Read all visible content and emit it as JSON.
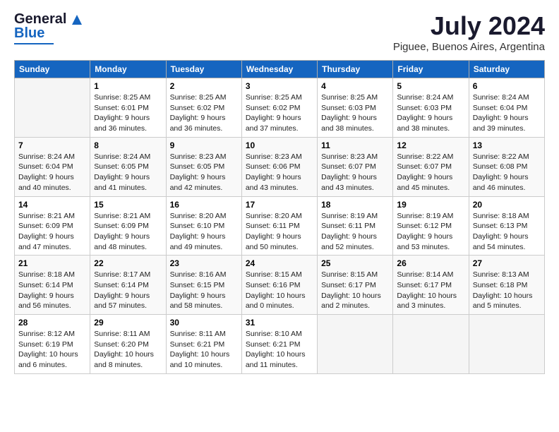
{
  "header": {
    "logo_line1": "General",
    "logo_line2": "Blue",
    "title": "July 2024",
    "subtitle": "Piguee, Buenos Aires, Argentina"
  },
  "days_of_week": [
    "Sunday",
    "Monday",
    "Tuesday",
    "Wednesday",
    "Thursday",
    "Friday",
    "Saturday"
  ],
  "weeks": [
    [
      {
        "num": "",
        "sunrise": "",
        "sunset": "",
        "daylight": ""
      },
      {
        "num": "1",
        "sunrise": "Sunrise: 8:25 AM",
        "sunset": "Sunset: 6:01 PM",
        "daylight": "Daylight: 9 hours and 36 minutes."
      },
      {
        "num": "2",
        "sunrise": "Sunrise: 8:25 AM",
        "sunset": "Sunset: 6:02 PM",
        "daylight": "Daylight: 9 hours and 36 minutes."
      },
      {
        "num": "3",
        "sunrise": "Sunrise: 8:25 AM",
        "sunset": "Sunset: 6:02 PM",
        "daylight": "Daylight: 9 hours and 37 minutes."
      },
      {
        "num": "4",
        "sunrise": "Sunrise: 8:25 AM",
        "sunset": "Sunset: 6:03 PM",
        "daylight": "Daylight: 9 hours and 38 minutes."
      },
      {
        "num": "5",
        "sunrise": "Sunrise: 8:24 AM",
        "sunset": "Sunset: 6:03 PM",
        "daylight": "Daylight: 9 hours and 38 minutes."
      },
      {
        "num": "6",
        "sunrise": "Sunrise: 8:24 AM",
        "sunset": "Sunset: 6:04 PM",
        "daylight": "Daylight: 9 hours and 39 minutes."
      }
    ],
    [
      {
        "num": "7",
        "sunrise": "Sunrise: 8:24 AM",
        "sunset": "Sunset: 6:04 PM",
        "daylight": "Daylight: 9 hours and 40 minutes."
      },
      {
        "num": "8",
        "sunrise": "Sunrise: 8:24 AM",
        "sunset": "Sunset: 6:05 PM",
        "daylight": "Daylight: 9 hours and 41 minutes."
      },
      {
        "num": "9",
        "sunrise": "Sunrise: 8:23 AM",
        "sunset": "Sunset: 6:05 PM",
        "daylight": "Daylight: 9 hours and 42 minutes."
      },
      {
        "num": "10",
        "sunrise": "Sunrise: 8:23 AM",
        "sunset": "Sunset: 6:06 PM",
        "daylight": "Daylight: 9 hours and 43 minutes."
      },
      {
        "num": "11",
        "sunrise": "Sunrise: 8:23 AM",
        "sunset": "Sunset: 6:07 PM",
        "daylight": "Daylight: 9 hours and 43 minutes."
      },
      {
        "num": "12",
        "sunrise": "Sunrise: 8:22 AM",
        "sunset": "Sunset: 6:07 PM",
        "daylight": "Daylight: 9 hours and 45 minutes."
      },
      {
        "num": "13",
        "sunrise": "Sunrise: 8:22 AM",
        "sunset": "Sunset: 6:08 PM",
        "daylight": "Daylight: 9 hours and 46 minutes."
      }
    ],
    [
      {
        "num": "14",
        "sunrise": "Sunrise: 8:21 AM",
        "sunset": "Sunset: 6:09 PM",
        "daylight": "Daylight: 9 hours and 47 minutes."
      },
      {
        "num": "15",
        "sunrise": "Sunrise: 8:21 AM",
        "sunset": "Sunset: 6:09 PM",
        "daylight": "Daylight: 9 hours and 48 minutes."
      },
      {
        "num": "16",
        "sunrise": "Sunrise: 8:20 AM",
        "sunset": "Sunset: 6:10 PM",
        "daylight": "Daylight: 9 hours and 49 minutes."
      },
      {
        "num": "17",
        "sunrise": "Sunrise: 8:20 AM",
        "sunset": "Sunset: 6:11 PM",
        "daylight": "Daylight: 9 hours and 50 minutes."
      },
      {
        "num": "18",
        "sunrise": "Sunrise: 8:19 AM",
        "sunset": "Sunset: 6:11 PM",
        "daylight": "Daylight: 9 hours and 52 minutes."
      },
      {
        "num": "19",
        "sunrise": "Sunrise: 8:19 AM",
        "sunset": "Sunset: 6:12 PM",
        "daylight": "Daylight: 9 hours and 53 minutes."
      },
      {
        "num": "20",
        "sunrise": "Sunrise: 8:18 AM",
        "sunset": "Sunset: 6:13 PM",
        "daylight": "Daylight: 9 hours and 54 minutes."
      }
    ],
    [
      {
        "num": "21",
        "sunrise": "Sunrise: 8:18 AM",
        "sunset": "Sunset: 6:14 PM",
        "daylight": "Daylight: 9 hours and 56 minutes."
      },
      {
        "num": "22",
        "sunrise": "Sunrise: 8:17 AM",
        "sunset": "Sunset: 6:14 PM",
        "daylight": "Daylight: 9 hours and 57 minutes."
      },
      {
        "num": "23",
        "sunrise": "Sunrise: 8:16 AM",
        "sunset": "Sunset: 6:15 PM",
        "daylight": "Daylight: 9 hours and 58 minutes."
      },
      {
        "num": "24",
        "sunrise": "Sunrise: 8:15 AM",
        "sunset": "Sunset: 6:16 PM",
        "daylight": "Daylight: 10 hours and 0 minutes."
      },
      {
        "num": "25",
        "sunrise": "Sunrise: 8:15 AM",
        "sunset": "Sunset: 6:17 PM",
        "daylight": "Daylight: 10 hours and 2 minutes."
      },
      {
        "num": "26",
        "sunrise": "Sunrise: 8:14 AM",
        "sunset": "Sunset: 6:17 PM",
        "daylight": "Daylight: 10 hours and 3 minutes."
      },
      {
        "num": "27",
        "sunrise": "Sunrise: 8:13 AM",
        "sunset": "Sunset: 6:18 PM",
        "daylight": "Daylight: 10 hours and 5 minutes."
      }
    ],
    [
      {
        "num": "28",
        "sunrise": "Sunrise: 8:12 AM",
        "sunset": "Sunset: 6:19 PM",
        "daylight": "Daylight: 10 hours and 6 minutes."
      },
      {
        "num": "29",
        "sunrise": "Sunrise: 8:11 AM",
        "sunset": "Sunset: 6:20 PM",
        "daylight": "Daylight: 10 hours and 8 minutes."
      },
      {
        "num": "30",
        "sunrise": "Sunrise: 8:11 AM",
        "sunset": "Sunset: 6:21 PM",
        "daylight": "Daylight: 10 hours and 10 minutes."
      },
      {
        "num": "31",
        "sunrise": "Sunrise: 8:10 AM",
        "sunset": "Sunset: 6:21 PM",
        "daylight": "Daylight: 10 hours and 11 minutes."
      },
      {
        "num": "",
        "sunrise": "",
        "sunset": "",
        "daylight": ""
      },
      {
        "num": "",
        "sunrise": "",
        "sunset": "",
        "daylight": ""
      },
      {
        "num": "",
        "sunrise": "",
        "sunset": "",
        "daylight": ""
      }
    ]
  ]
}
